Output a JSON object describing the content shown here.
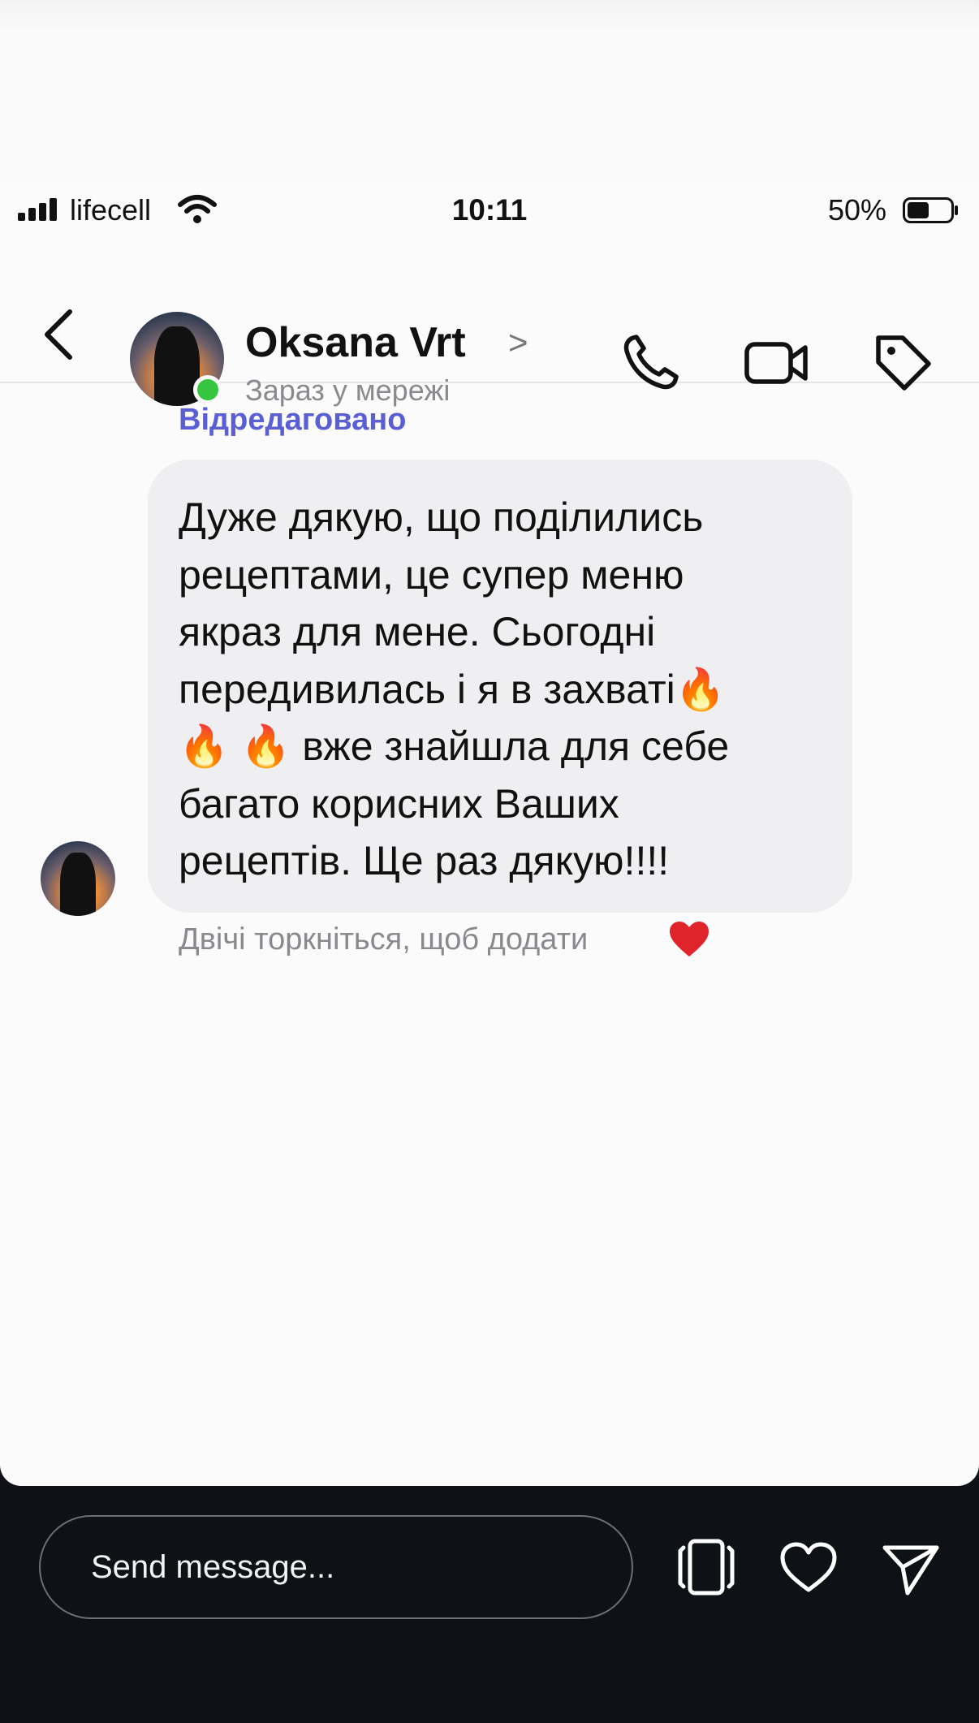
{
  "status_bar": {
    "carrier": "lifecell",
    "time": "10:11",
    "battery_percent": "50%",
    "battery_level": 0.5
  },
  "header": {
    "contact_name": "Oksana Vrt",
    "chevron": ">",
    "presence": "Зараз у мережі",
    "icons": [
      "back-arrow-icon",
      "phone-icon",
      "video-camera-icon",
      "tag-icon"
    ]
  },
  "conversation": {
    "edited_label": "Відредаговано",
    "message_lines": [
      "Дуже дякую, що поділились",
      "рецептами, це супер меню",
      "якраз для мене.  Сьогодні",
      "передивилась і я в захваті🔥",
      "🔥 🔥  вже знайшла для себе",
      "багато корисних Ваших",
      "рецептів. Ще раз дякую!!!!"
    ],
    "double_tap_hint": "Двічі торкніться, щоб додати",
    "hint_icon": "red-heart-icon"
  },
  "story_bar": {
    "input_placeholder": "Send message...",
    "icons": [
      "stories-icon",
      "heart-icon",
      "send-icon"
    ]
  },
  "colors": {
    "edited_label": "#5b5fd6",
    "online_dot": "#35c53e",
    "bubble": "#efeff2",
    "story_bar_bg": "#0e1115"
  }
}
